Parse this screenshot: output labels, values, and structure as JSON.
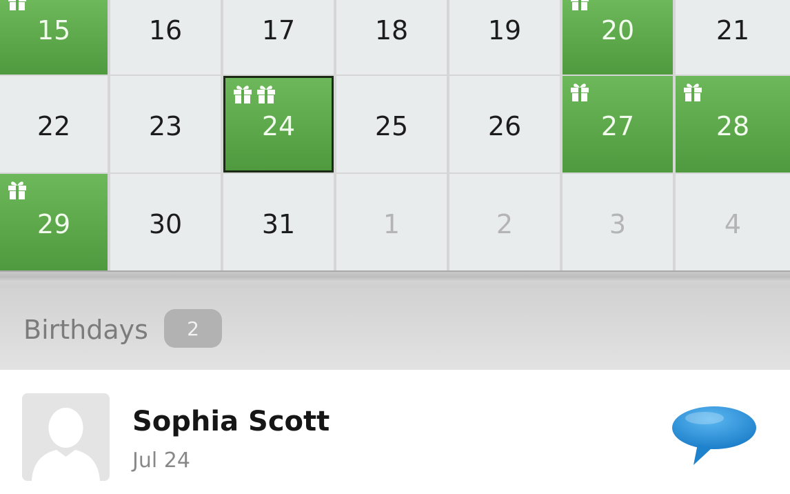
{
  "calendar": {
    "weeks": [
      [
        {
          "day": "15",
          "birthday": true,
          "gifts": 1
        },
        {
          "day": "16"
        },
        {
          "day": "17"
        },
        {
          "day": "18"
        },
        {
          "day": "19"
        },
        {
          "day": "20",
          "birthday": true,
          "gifts": 1
        },
        {
          "day": "21"
        }
      ],
      [
        {
          "day": "22"
        },
        {
          "day": "23"
        },
        {
          "day": "24",
          "birthday": true,
          "gifts": 2,
          "selected": true
        },
        {
          "day": "25"
        },
        {
          "day": "26"
        },
        {
          "day": "27",
          "birthday": true,
          "gifts": 1
        },
        {
          "day": "28",
          "birthday": true,
          "gifts": 1
        }
      ],
      [
        {
          "day": "29",
          "birthday": true,
          "gifts": 1
        },
        {
          "day": "30"
        },
        {
          "day": "31"
        },
        {
          "day": "1",
          "other_month": true
        },
        {
          "day": "2",
          "other_month": true
        },
        {
          "day": "3",
          "other_month": true
        },
        {
          "day": "4",
          "other_month": true
        }
      ]
    ],
    "gift_icon": "gift-icon"
  },
  "birthdays": {
    "title": "Birthdays",
    "count": "2"
  },
  "list": [
    {
      "name": "Sophia Scott",
      "date": "Jul 24",
      "avatar_icon": "person-silhouette-icon",
      "action_icon": "speech-bubble-icon"
    }
  ],
  "colors": {
    "birthday_green": "#5fab4c",
    "cell_gray": "#e9ecec",
    "message_blue": "#2b8fd8"
  }
}
